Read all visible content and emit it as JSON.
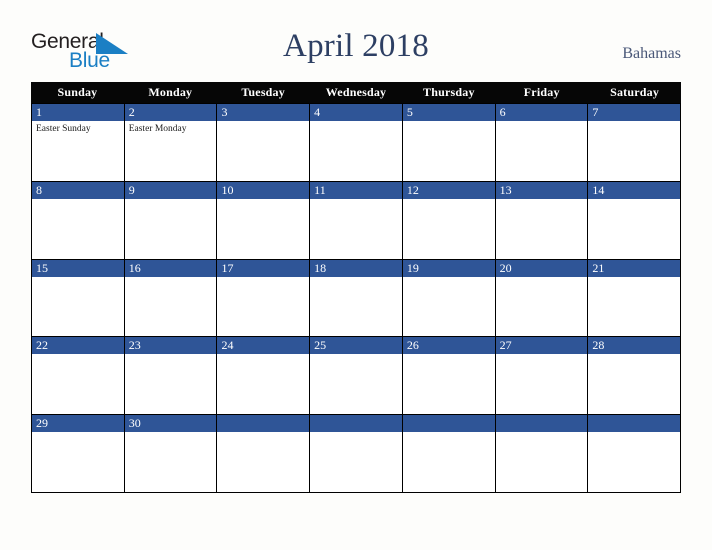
{
  "brand": {
    "name_part1": "General",
    "name_part2": "Blue",
    "triangle_color": "#1b7fc4",
    "text_color": "#231f20"
  },
  "header": {
    "title": "April 2018",
    "country": "Bahamas",
    "title_color": "#2d3f63",
    "country_color": "#4a5878"
  },
  "theme": {
    "background": "#fdfdfb",
    "weekday_header_bg": "#060606",
    "weekday_header_text": "#ffffff",
    "date_bar_bg": "#2f5597",
    "date_bar_text": "#ffffff",
    "cell_bg": "#ffffff",
    "grid_line": "#000000",
    "holiday_text": "#1b1b1b"
  },
  "weekdays": [
    "Sunday",
    "Monday",
    "Tuesday",
    "Wednesday",
    "Thursday",
    "Friday",
    "Saturday"
  ],
  "weeks": [
    [
      {
        "date": "1",
        "holidays": [
          "Easter Sunday"
        ]
      },
      {
        "date": "2",
        "holidays": [
          "Easter Monday"
        ]
      },
      {
        "date": "3",
        "holidays": []
      },
      {
        "date": "4",
        "holidays": []
      },
      {
        "date": "5",
        "holidays": []
      },
      {
        "date": "6",
        "holidays": []
      },
      {
        "date": "7",
        "holidays": []
      }
    ],
    [
      {
        "date": "8",
        "holidays": []
      },
      {
        "date": "9",
        "holidays": []
      },
      {
        "date": "10",
        "holidays": []
      },
      {
        "date": "11",
        "holidays": []
      },
      {
        "date": "12",
        "holidays": []
      },
      {
        "date": "13",
        "holidays": []
      },
      {
        "date": "14",
        "holidays": []
      }
    ],
    [
      {
        "date": "15",
        "holidays": []
      },
      {
        "date": "16",
        "holidays": []
      },
      {
        "date": "17",
        "holidays": []
      },
      {
        "date": "18",
        "holidays": []
      },
      {
        "date": "19",
        "holidays": []
      },
      {
        "date": "20",
        "holidays": []
      },
      {
        "date": "21",
        "holidays": []
      }
    ],
    [
      {
        "date": "22",
        "holidays": []
      },
      {
        "date": "23",
        "holidays": []
      },
      {
        "date": "24",
        "holidays": []
      },
      {
        "date": "25",
        "holidays": []
      },
      {
        "date": "26",
        "holidays": []
      },
      {
        "date": "27",
        "holidays": []
      },
      {
        "date": "28",
        "holidays": []
      }
    ],
    [
      {
        "date": "29",
        "holidays": []
      },
      {
        "date": "30",
        "holidays": []
      },
      {
        "date": "",
        "holidays": []
      },
      {
        "date": "",
        "holidays": []
      },
      {
        "date": "",
        "holidays": []
      },
      {
        "date": "",
        "holidays": []
      },
      {
        "date": "",
        "holidays": []
      }
    ]
  ]
}
